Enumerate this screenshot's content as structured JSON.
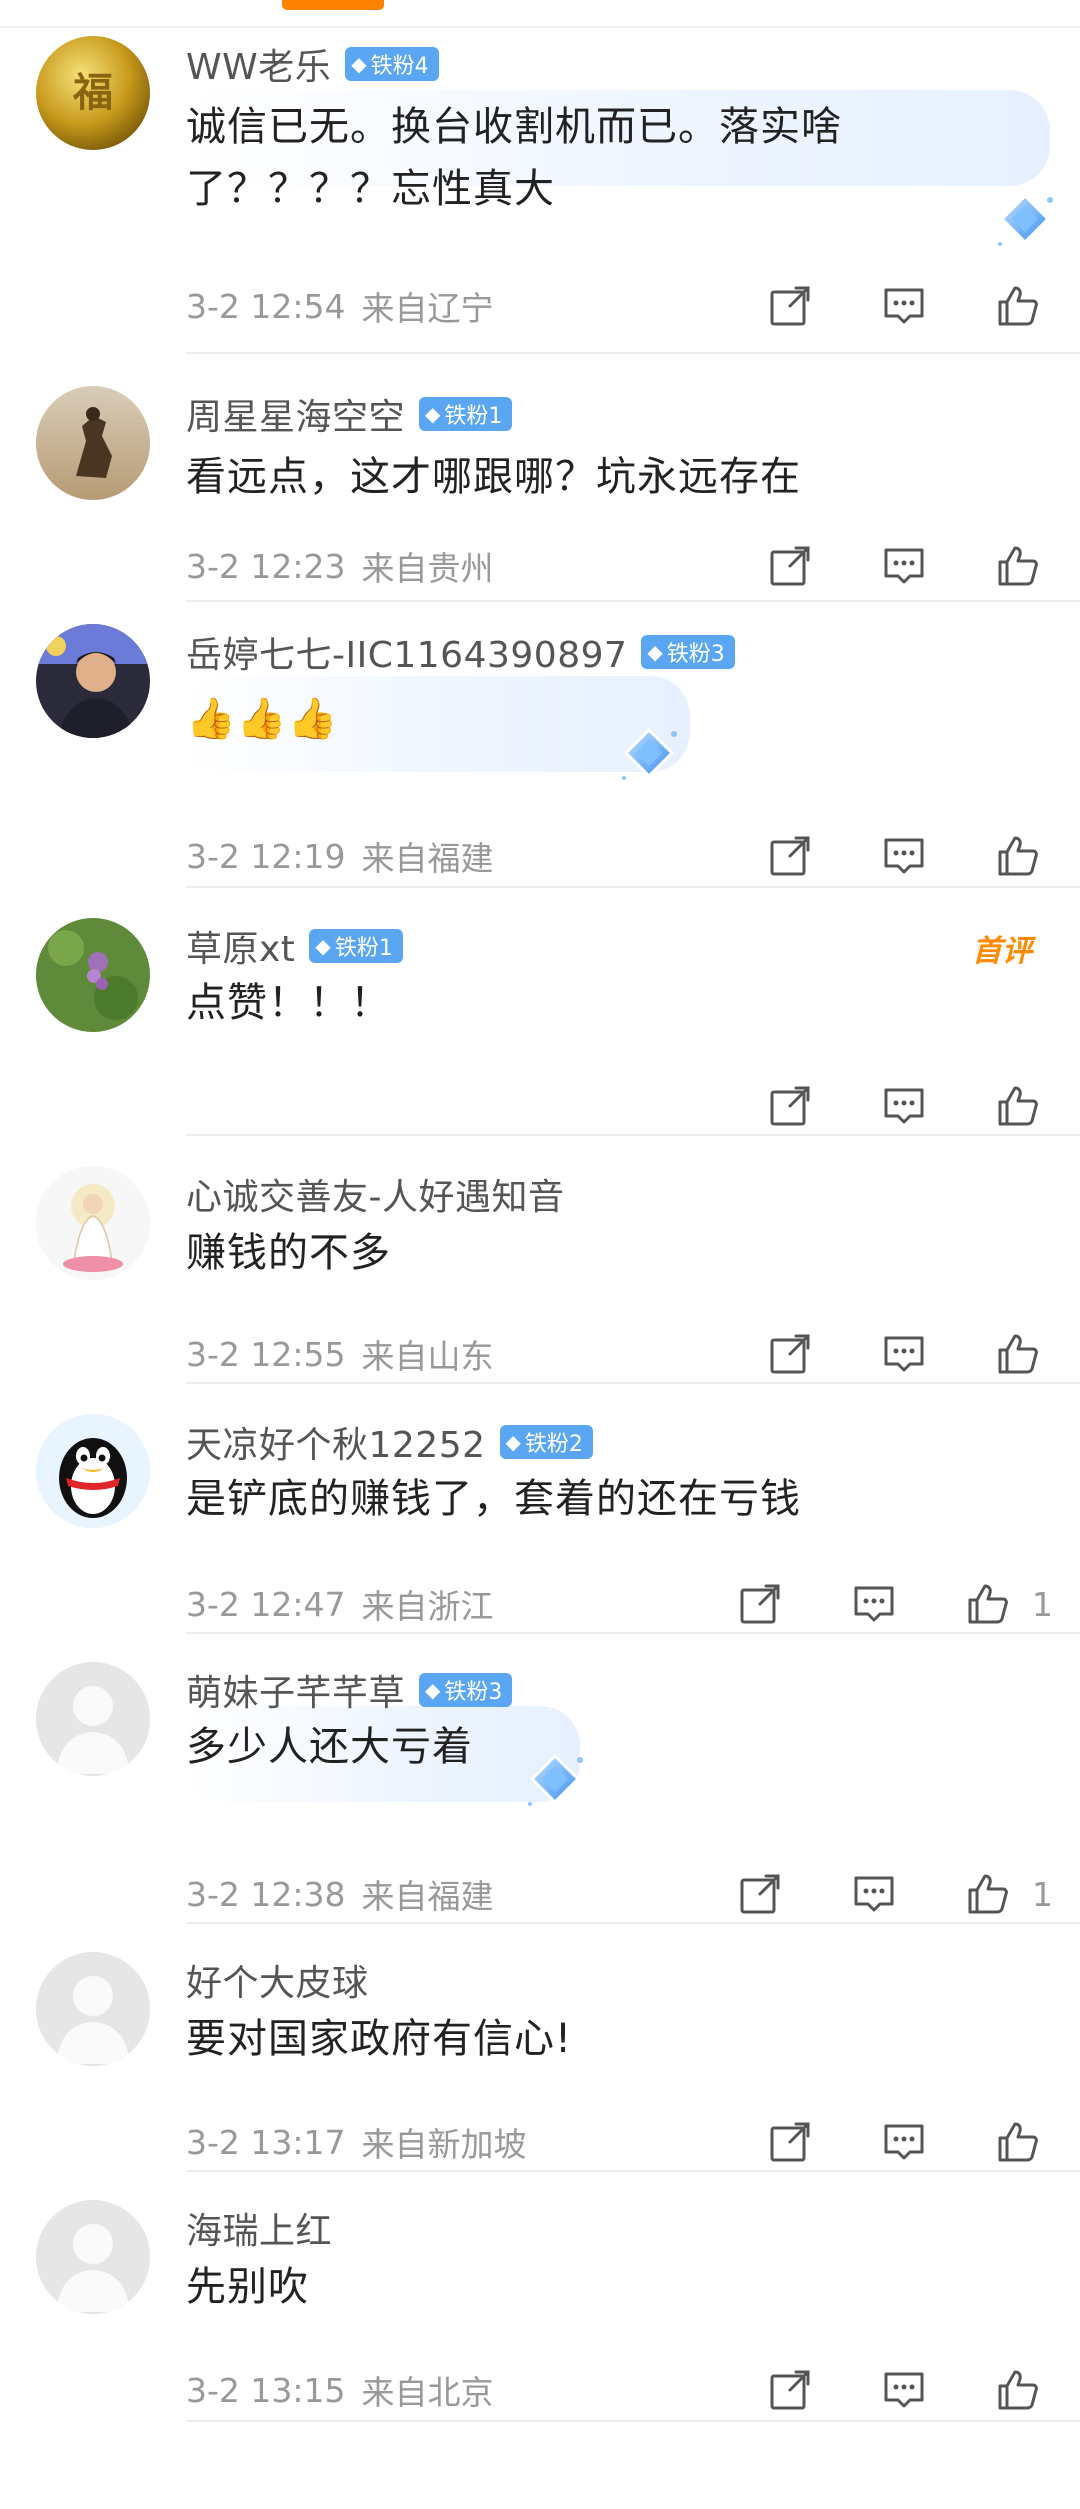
{
  "badge_prefix": "铁粉",
  "first_comment_tag": "首评",
  "colors": {
    "accent": "#ff8200",
    "badge": "#5aa6f2",
    "meta": "#999999"
  },
  "comments": [
    {
      "username": "WW老乐",
      "fan_level": "4",
      "text": [
        "诚信已无。换台收割机而已。落实啥",
        "了？？？？忘性真大"
      ],
      "time": "3-2 12:54",
      "location": "来自辽宁",
      "likes": "",
      "avatar": "gold-coin-avatar",
      "highlight": true
    },
    {
      "username": "周星星海空空",
      "fan_level": "1",
      "text": [
        "看远点，这才哪跟哪？坑永远存在"
      ],
      "time": "3-2 12:23",
      "location": "来自贵州",
      "likes": "",
      "avatar": "horse-statue-avatar",
      "highlight": false
    },
    {
      "username": "岳婷七七-IIC1164390897",
      "fan_level": "3",
      "text": [
        "👍👍👍"
      ],
      "time": "3-2 12:19",
      "location": "来自福建",
      "likes": "",
      "avatar": "man-portrait-avatar",
      "highlight": true
    },
    {
      "username": "草原xt",
      "fan_level": "1",
      "text": [
        "点赞！！！"
      ],
      "time": "",
      "location": "",
      "likes": "",
      "avatar": "green-plant-avatar",
      "highlight": false
    },
    {
      "username": "心诚交善友-人好遇知音",
      "fan_level": "",
      "text": [
        "赚钱的不多"
      ],
      "time": "3-2 12:55",
      "location": "来自山东",
      "likes": "",
      "avatar": "guanyin-avatar",
      "highlight": false
    },
    {
      "username": "天凉好个秋12252",
      "fan_level": "2",
      "text": [
        "是铲底的赚钱了，套着的还在亏钱"
      ],
      "time": "3-2 12:47",
      "location": "来自浙江",
      "likes": "1",
      "avatar": "penguin-avatar",
      "highlight": false
    },
    {
      "username": "萌妹子芊芊草",
      "fan_level": "3",
      "text": [
        "多少人还大亏着"
      ],
      "time": "3-2 12:38",
      "location": "来自福建",
      "likes": "1",
      "avatar": "default-avatar",
      "highlight": true
    },
    {
      "username": "好个大皮球",
      "fan_level": "",
      "text": [
        "要对国家政府有信心!"
      ],
      "time": "3-2 13:17",
      "location": "来自新加坡",
      "likes": "",
      "avatar": "default-avatar",
      "highlight": false
    },
    {
      "username": "海瑞上红",
      "fan_level": "",
      "text": [
        "先别吹"
      ],
      "time": "3-2 13:15",
      "location": "来自北京",
      "likes": "",
      "avatar": "default-avatar",
      "highlight": false
    }
  ]
}
